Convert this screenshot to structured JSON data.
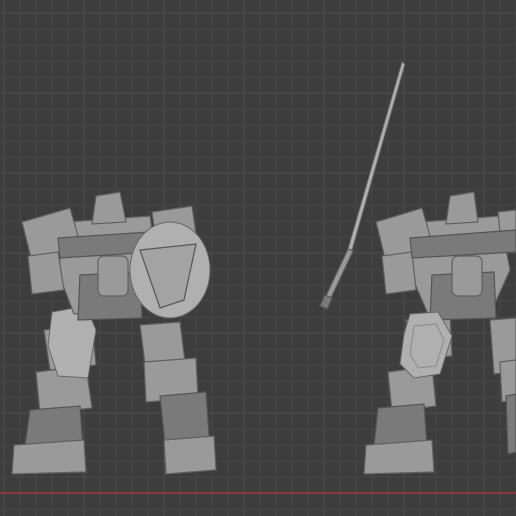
{
  "viewport": {
    "background_color": "#3d3d3d",
    "grid_minor_color": "#474747",
    "grid_major_color": "#505050",
    "x_axis_color": "#a0383f"
  },
  "objects": [
    {
      "name": "mecha-with-shield",
      "selected": false
    },
    {
      "name": "spear",
      "selected": false
    },
    {
      "name": "mecha-assembled",
      "selected": false
    },
    {
      "name": "thigh-armor-plate",
      "selected": true
    }
  ],
  "selection_color": "#e8872d"
}
